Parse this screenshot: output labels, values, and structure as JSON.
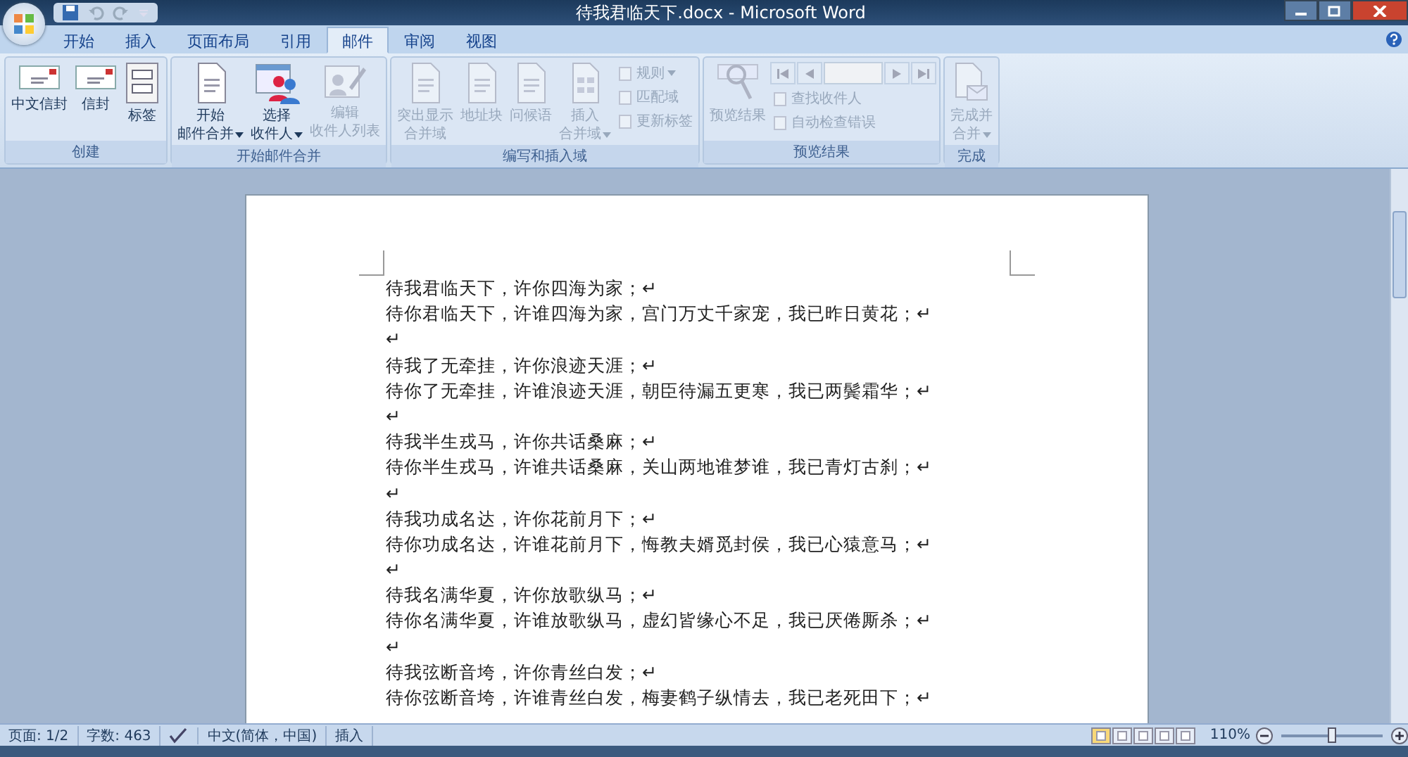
{
  "window": {
    "title": "待我君临天下.docx - Microsoft Word"
  },
  "tabs": [
    {
      "label": "开始",
      "selected": false
    },
    {
      "label": "插入",
      "selected": false
    },
    {
      "label": "页面布局",
      "selected": false
    },
    {
      "label": "引用",
      "selected": false
    },
    {
      "label": "邮件",
      "selected": true
    },
    {
      "label": "审阅",
      "selected": false
    },
    {
      "label": "视图",
      "selected": false
    }
  ],
  "ribbon": {
    "groups": [
      {
        "title": "创建",
        "large_buttons": [
          {
            "kind": "envelope",
            "lines": [
              "中文信封"
            ],
            "disabled": false
          },
          {
            "kind": "envelope",
            "lines": [
              "信封"
            ],
            "disabled": false
          },
          {
            "kind": "labels",
            "lines": [
              "标签"
            ],
            "disabled": false
          }
        ]
      },
      {
        "title": "开始邮件合并",
        "large_buttons": [
          {
            "kind": "document",
            "lines": [
              "开始",
              "邮件合并"
            ],
            "dropdown": true,
            "disabled": false
          },
          {
            "kind": "people",
            "lines": [
              "选择",
              "收件人"
            ],
            "dropdown": true,
            "disabled": false
          },
          {
            "kind": "edit",
            "lines": [
              "编辑",
              "收件人列表"
            ],
            "disabled": true
          }
        ]
      },
      {
        "title": "编写和插入域",
        "large_buttons": [
          {
            "kind": "document",
            "lines": [
              "突出显示",
              "合并域"
            ],
            "disabled": true
          },
          {
            "kind": "document",
            "lines": [
              "地址块"
            ],
            "disabled": true
          },
          {
            "kind": "document",
            "lines": [
              "问候语"
            ],
            "disabled": true
          },
          {
            "kind": "grid",
            "lines": [
              "插入",
              "合并域"
            ],
            "dropdown": true,
            "disabled": true
          }
        ],
        "small_buttons": [
          {
            "label": "规则",
            "dropdown": true,
            "disabled": true
          },
          {
            "label": "匹配域",
            "disabled": true
          },
          {
            "label": "更新标签",
            "disabled": true
          }
        ]
      },
      {
        "title": "预览结果",
        "large_buttons": [
          {
            "kind": "magnifier",
            "lines": [
              "预览结果"
            ],
            "disabled": true
          }
        ],
        "navigation": {
          "disabled": true
        },
        "small_buttons": [
          {
            "label": "查找收件人",
            "disabled": true
          },
          {
            "label": "自动检查错误",
            "disabled": true
          }
        ]
      },
      {
        "title": "完成",
        "large_buttons": [
          {
            "kind": "finish",
            "lines": [
              "完成并",
              "合并"
            ],
            "dropdown": true,
            "disabled": true
          }
        ]
      }
    ]
  },
  "document": {
    "lines": [
      "待我君临天下，许你四海为家；↵",
      "待你君临天下，许谁四海为家，宫门万丈千家宠，我已昨日黄花；↵",
      "↵",
      "待我了无牵挂，许你浪迹天涯；↵",
      "待你了无牵挂，许谁浪迹天涯，朝臣待漏五更寒，我已两鬓霜华；↵",
      "↵",
      "待我半生戎马，许你共话桑麻；↵",
      "待你半生戎马，许谁共话桑麻，关山两地谁梦谁，我已青灯古刹；↵",
      "↵",
      "待我功成名达，许你花前月下；↵",
      "待你功成名达，许谁花前月下，悔教夫婿觅封侯，我已心猿意马；↵",
      "↵",
      "待我名满华夏，许你放歌纵马；↵",
      "待你名满华夏，许谁放歌纵马，虚幻皆缘心不足，我已厌倦厮杀；↵",
      "↵",
      "待我弦断音垮，许你青丝白发；↵",
      "待你弦断音垮，许谁青丝白发，梅妻鹤子纵情去，我已老死田下；↵"
    ]
  },
  "status_bar": {
    "page": "页面: 1/2",
    "words": "字数: 463",
    "language": "中文(简体，中国)",
    "mode": "插入",
    "zoom": "110%",
    "zoom_slider": {
      "level": 0.5
    }
  }
}
